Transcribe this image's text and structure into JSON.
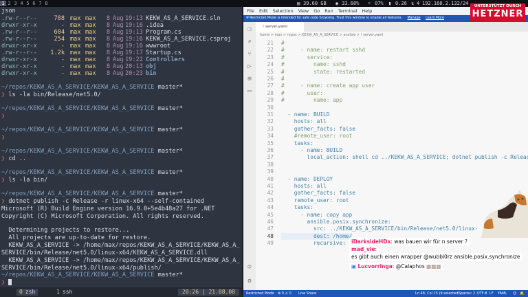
{
  "topbar": {
    "workspaces": [
      "1",
      "2",
      "3",
      "4",
      "5",
      "6",
      "7",
      "8"
    ],
    "active_workspace": "1",
    "cpu_temp": "39.60 GB",
    "ram": "33.68%",
    "disk": "07%",
    "load": "0.26",
    "net": "4",
    "ip": "192.168.2.132/24"
  },
  "logo": {
    "line1": "UNTERSTÜTZT DURCH",
    "line2": "HETZNER"
  },
  "terminal": {
    "header": "json",
    "ls_rows": [
      {
        "perm": ".rw-r--r--",
        "size": "788",
        "user": "max",
        "group": "max",
        "day": "8",
        "mon": "Aug",
        "time": "19:13",
        "name": "KEKW_AS_A_SERVICE.sln",
        "dir": false
      },
      {
        "perm": "drwxr-xr-x",
        "size": "-",
        "user": "max",
        "group": "max",
        "day": "8",
        "mon": "Aug",
        "time": "19:16",
        "name": ".idea",
        "dir": false
      },
      {
        "perm": ".rw-r--r--",
        "size": "604",
        "user": "max",
        "group": "max",
        "day": "8",
        "mon": "Aug",
        "time": "19:13",
        "name": "Program.cs",
        "dir": false
      },
      {
        "perm": ".rw-r--r--",
        "size": "254",
        "user": "max",
        "group": "max",
        "day": "8",
        "mon": "Aug",
        "time": "19:16",
        "name": "KEKW_AS_A_SERVICE.csproj",
        "dir": false
      },
      {
        "perm": "drwxr-xr-x",
        "size": "-",
        "user": "max",
        "group": "max",
        "day": "8",
        "mon": "Aug",
        "time": "19:16",
        "name": "wwwroot",
        "dir": false
      },
      {
        "perm": ".rw-r--r--",
        "size": "1.2k",
        "user": "max",
        "group": "max",
        "day": "8",
        "mon": "Aug",
        "time": "19:17",
        "name": "Startup.cs",
        "dir": false
      },
      {
        "perm": "drwxr-xr-x",
        "size": "-",
        "user": "max",
        "group": "max",
        "day": "8",
        "mon": "Aug",
        "time": "19:22",
        "name": "Controllers",
        "dir": true
      },
      {
        "perm": "drwxr-xr-x",
        "size": "-",
        "user": "max",
        "group": "max",
        "day": "8",
        "mon": "Aug",
        "time": "20:13",
        "name": "obj",
        "dir": true
      },
      {
        "perm": "drwxr-xr-x",
        "size": "-",
        "user": "max",
        "group": "max",
        "day": "8",
        "mon": "Aug",
        "time": "20:23",
        "name": "bin",
        "dir": true
      }
    ],
    "path_prompt": "~/repos/KEKW_AS_A_SERVICE/KEKW_AS_A_SERVICE",
    "branch": "master*",
    "prompt_char": "❯",
    "cmd1": "ls -la bin/Release/net5.0/",
    "cmd2": "cd ..",
    "cmd3": "ls -la bin/",
    "cmd4": "dotnet publish -c Release -r linux-x64 --self-contained",
    "out1": "Microsoft (R) Build Engine version 16.9.0+5e4b48a27 for .NET",
    "out2": "Copyright (C) Microsoft Corporation. All rights reserved.",
    "out3": "  Determining projects to restore...",
    "out4": "  All projects are up-to-date for restore.",
    "out5": "  KEKW_AS_A_SERVICE -> /home/max/repos/KEKW_AS_A_SERVICE/KEKW_AS_A_",
    "out6": "SERVICE/bin/Release/net5.0/linux-x64/KEKW_AS_A_SERVICE.dll",
    "out7": "  KEKW_AS_A_SERVICE -> /home/max/repos/KEKW_AS_A_SERVICE/KEKW_AS_A_",
    "out8": "SERVICE/bin/Release/net5.0/linux-x64/publish/",
    "tmux_tabs": [
      {
        "num": "0",
        "name": "zsh",
        "active": true
      },
      {
        "num": "1",
        "name": "ssh",
        "active": false
      }
    ],
    "tmux_time": "20:26 | 21.08.08"
  },
  "vscode": {
    "menus": [
      "File",
      "Edit",
      "Selection",
      "View",
      "Go",
      "Run",
      "Terminal",
      "Help"
    ],
    "restricted_text": "Restricted Mode is intended for safe code browsing. Trust this window to enable all features.",
    "restricted_manage": "Manage",
    "restricted_learn": "Learn More",
    "tab_name": "server.yaml",
    "breadcrumb": "home > max > repos > KEKW_AS_A_SERVICE > ansible > ! server.yaml",
    "code_lines": [
      {
        "n": "21",
        "t": "#",
        "cls": "cm"
      },
      {
        "n": "22",
        "t": "#     - name: restart sshd",
        "cls": "cm"
      },
      {
        "n": "23",
        "t": "#       service:",
        "cls": "cm"
      },
      {
        "n": "24",
        "t": "#         name: sshd",
        "cls": "cm"
      },
      {
        "n": "25",
        "t": "#         state: restarted",
        "cls": "cm"
      },
      {
        "n": "26",
        "t": "#",
        "cls": "cm"
      },
      {
        "n": "27",
        "t": "#     - name: create app user",
        "cls": "cm"
      },
      {
        "n": "28",
        "t": "#       user:",
        "cls": "cm"
      },
      {
        "n": "29",
        "t": "#         name: app",
        "cls": "cm"
      },
      {
        "n": "30",
        "t": "",
        "cls": ""
      },
      {
        "n": "31",
        "t": "  - name: BUILD",
        "cls": "k"
      },
      {
        "n": "32",
        "t": "    hosts: all",
        "cls": "k"
      },
      {
        "n": "33",
        "t": "    gather_facts: false",
        "cls": "k"
      },
      {
        "n": "34",
        "t": "    #remote_user: root",
        "cls": "cm"
      },
      {
        "n": "35",
        "t": "    tasks:",
        "cls": "k"
      },
      {
        "n": "36",
        "t": "      - name: BUILD",
        "cls": "k"
      },
      {
        "n": "37",
        "t": "        local_action: shell cd ../KEKW_AS_A_SERVICE; dotnet publish -c Release",
        "cls": "k"
      },
      {
        "n": "38",
        "t": "",
        "cls": ""
      },
      {
        "n": "39",
        "t": "",
        "cls": ""
      },
      {
        "n": "40",
        "t": "  - name: DEPLOY",
        "cls": "k"
      },
      {
        "n": "41",
        "t": "    hosts: all",
        "cls": "k"
      },
      {
        "n": "42",
        "t": "    gather_facts: false",
        "cls": "k"
      },
      {
        "n": "43",
        "t": "    remote_user: root",
        "cls": "k"
      },
      {
        "n": "44",
        "t": "    tasks:",
        "cls": "k"
      },
      {
        "n": "45",
        "t": "      - name: copy app",
        "cls": "k"
      },
      {
        "n": "46",
        "t": "        ansible.posix.synchronize:",
        "cls": "k"
      },
      {
        "n": "47",
        "t": "          src: ../KEKW_AS_A_SERVICE/bin/Release/net5.0/linux-",
        "cls": "k"
      },
      {
        "n": "48",
        "t": "          dest: /home/",
        "cls": "k"
      },
      {
        "n": "49",
        "t": "          recursive: no",
        "cls": "k"
      }
    ],
    "current_line": "48",
    "status": {
      "mode": "Restricted Mode",
      "errors": "⊗ 0 ⚠ 0",
      "live_share": "Live Share",
      "position": "Ln 48, Col 15 (9 selected)",
      "spaces": "Spaces: 2",
      "encoding": "UTF-8",
      "eol": "LF",
      "lang": "YAML"
    }
  },
  "chat": [
    {
      "name": "iDarksideHDx",
      "name_color": "#e91e63",
      "text": ": was bauen wir für n server ?"
    },
    {
      "name": "mad_vie",
      "name_color": "#e91e63",
      "text": ":"
    },
    {
      "name": "",
      "name_color": "#111111",
      "text": "es gibt auch einen wrapper @wubbl0rz ansible.posix.synchronize"
    },
    {
      "name": "Lucvorringa",
      "name_color": "#e91e63",
      "text": ": @Calaphos"
    }
  ]
}
